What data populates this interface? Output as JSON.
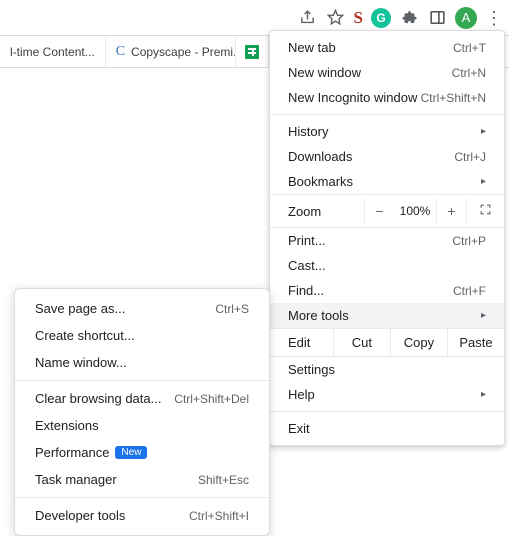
{
  "toolbar": {
    "avatar_letter": "A",
    "ext_s": "S",
    "ext_g": "G"
  },
  "tabs": [
    {
      "label": "l-time Content..."
    },
    {
      "label": "Copyscape - Premi..."
    },
    {
      "label": ""
    }
  ],
  "menu": {
    "new_tab": "New tab",
    "new_tab_sc": "Ctrl+T",
    "new_window": "New window",
    "new_window_sc": "Ctrl+N",
    "incognito": "New Incognito window",
    "incognito_sc": "Ctrl+Shift+N",
    "history": "History",
    "downloads": "Downloads",
    "downloads_sc": "Ctrl+J",
    "bookmarks": "Bookmarks",
    "zoom_label": "Zoom",
    "zoom_value": "100%",
    "zoom_minus": "−",
    "zoom_plus": "+",
    "print": "Print...",
    "print_sc": "Ctrl+P",
    "cast": "Cast...",
    "find": "Find...",
    "find_sc": "Ctrl+F",
    "more_tools": "More tools",
    "edit": "Edit",
    "cut": "Cut",
    "copy": "Copy",
    "paste": "Paste",
    "settings": "Settings",
    "help": "Help",
    "exit": "Exit"
  },
  "submenu": {
    "save_page": "Save page as...",
    "save_page_sc": "Ctrl+S",
    "create_shortcut": "Create shortcut...",
    "name_window": "Name window...",
    "clear_data": "Clear browsing data...",
    "clear_data_sc": "Ctrl+Shift+Del",
    "extensions": "Extensions",
    "performance": "Performance",
    "new_badge": "New",
    "task_manager": "Task manager",
    "task_manager_sc": "Shift+Esc",
    "devtools": "Developer tools",
    "devtools_sc": "Ctrl+Shift+I"
  }
}
